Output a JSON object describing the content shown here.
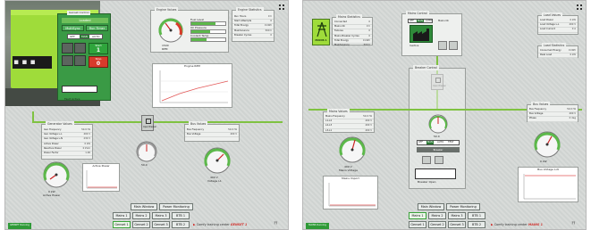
{
  "screen1": {
    "header": {
      "title": "Genset Control",
      "mode": "Loaded"
    },
    "tabs": [
      "MultiSync",
      "Run Timer"
    ],
    "mode_buttons": [
      "OFF",
      "MAN",
      "AUTO"
    ],
    "selected_mode": "MAN",
    "controls": {
      "start_label": "Start",
      "stop_label": "Stop",
      "start_value": "1",
      "stop_value": "0"
    },
    "fault_box": "Fault Active",
    "engine_values": {
      "title": "Engine Values",
      "gauge_value": "1500",
      "gauge_unit": "RPM",
      "bars": [
        "Fuel Level",
        "Oil Pressure",
        "Coolant Temp"
      ]
    },
    "engine_statistics": {
      "title": "Engine Statistics",
      "rows": [
        [
          "Run Hours",
          "0 h"
        ],
        [
          "Start Attempts",
          "0"
        ],
        [
          "Total Energy",
          "0 kWh"
        ],
        [
          "Maintenance",
          "500 h"
        ],
        [
          "Breaker Cycles",
          "0"
        ]
      ]
    },
    "engine_rpm_chart": {
      "title": "Engine RPM"
    },
    "generator_values": {
      "title": "Generator Values",
      "rows": [
        [
          "Gen Frequency",
          "50.0 Hz"
        ],
        [
          "Gen Voltage L-L",
          "400 V"
        ],
        [
          "Gen Voltage L-N",
          "230 V"
        ],
        [
          "Active Power",
          "0 kW"
        ],
        [
          "Reactive Power",
          "0 kVAr"
        ],
        [
          "Power Factor",
          "1.00"
        ]
      ]
    },
    "breaker_label": "Open Breaker",
    "bus_values": {
      "title": "Bus Values",
      "rows": [
        [
          "Bus Frequency",
          "50.0 Hz"
        ],
        [
          "Bus Voltage",
          "400 V"
        ]
      ]
    },
    "gauges": {
      "left_value": "0 kW",
      "left_caption": "Active Power",
      "mid_value": "50.0",
      "right_value": "400 V",
      "right_caption": "Voltage L1"
    },
    "power_chart": {
      "title": "Active Power"
    },
    "nav_buttons": [
      "Main Window",
      "Power Monitoring"
    ],
    "genset_buttons": [
      [
        "Mains 1",
        "Mains 2",
        "Mains 3",
        "BTB 1"
      ],
      [
        "Genset 1",
        "Genset 2",
        "Genset 3",
        "BTB 2"
      ]
    ],
    "status": "GENSET Running",
    "brand_text": "Comfy training center",
    "brand_name": "GENSET 1"
  },
  "screen2": {
    "mains_badge": "MAINS 1",
    "mains_statistics": {
      "title": "Mains Statistics",
      "rows": [
        [
          "Connected",
          "0"
        ],
        [
          "Mains Ok",
          "0 h"
        ],
        [
          "Failures",
          "0"
        ],
        [
          "Mains Breaker Cycles",
          "0"
        ],
        [
          "Total Energy",
          "0 kWh"
        ],
        [
          "Maintenance",
          "500 h"
        ]
      ]
    },
    "mains_control": {
      "title": "Mains Control",
      "mode_buttons": [
        "OFF",
        "MAN",
        "AUTO"
      ],
      "state": "Inactive",
      "note": "Mains Ok"
    },
    "load_values": {
      "title": "Load Values",
      "rows": [
        [
          "Load Power",
          "0 kW"
        ],
        [
          "Load Voltage L-L",
          "400 V"
        ],
        [
          "Load Current",
          "0 A"
        ]
      ]
    },
    "load_statistics": {
      "title": "Load Statistics",
      "rows": [
        [
          "Consumed Energy",
          "0 kWh"
        ],
        [
          "Peak Load",
          "0 kW"
        ]
      ]
    },
    "breaker_label": "Open Breaker",
    "mains_values": {
      "title": "Mains Values",
      "rows": [
        [
          "Mains Frequency",
          "50.0 Hz"
        ],
        [
          "L1-L2",
          "400 V"
        ],
        [
          "L2-L3",
          "400 V"
        ],
        [
          "L3-L1",
          "400 V"
        ]
      ]
    },
    "bus_values": {
      "title": "Bus Values",
      "rows": [
        [
          "Bus Frequency",
          "50.0 Hz"
        ],
        [
          "Bus Voltage",
          "400 V"
        ],
        [
          "Phase",
          "0 deg"
        ]
      ]
    },
    "breaker_control": {
      "title": "Breaker Control",
      "modes": [
        "OFF",
        "MAN",
        "AUTO",
        "TEST"
      ],
      "selected": "MAN",
      "state": "Breaker",
      "note": "Breaker Open"
    },
    "gauges": {
      "left_value": "400 V",
      "left_caption": "Mains Voltage",
      "mid_value": "50.0",
      "right_value": "0 kW"
    },
    "mains_import_chart": {
      "title": "Mains Import"
    },
    "bus_voltage_chart": {
      "title": "Bus Voltage L-N"
    },
    "nav_buttons": [
      "Main Window",
      "Power Monitoring"
    ],
    "mains_buttons": [
      [
        "Mains 1",
        "Mains 2",
        "Mains 3",
        "BTB 1"
      ],
      [
        "Genset 1",
        "Genset 2",
        "Genset 3",
        "BTB 2"
      ]
    ],
    "status": "MAINS Running",
    "brand_text": "Comfy training center",
    "brand_name": "MAINS 1"
  },
  "colors": {
    "bus": "#7fc241",
    "running": "#2f9a37",
    "stop": "#d93a2b",
    "genset": "#9fdc3a",
    "panel_green": "#3a9a45"
  },
  "icons": [
    "fullscreen-icon",
    "generator-icon",
    "breaker-icon",
    "factory-icon",
    "tower-icon",
    "logo-icon"
  ]
}
